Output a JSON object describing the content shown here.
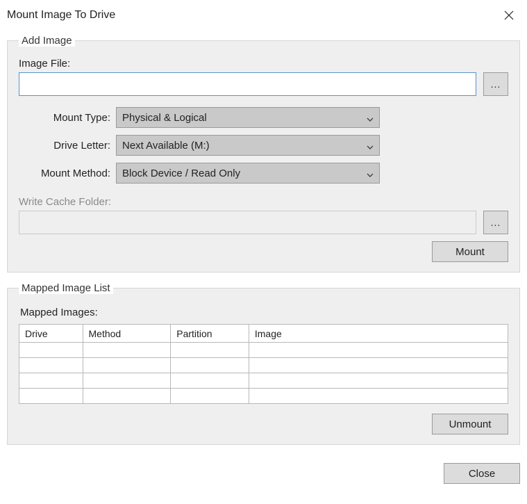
{
  "window": {
    "title": "Mount Image To Drive"
  },
  "addImage": {
    "legend": "Add Image",
    "imageFileLabel": "Image File:",
    "imageFileValue": "",
    "browseLabel": "...",
    "mountTypeLabel": "Mount Type:",
    "mountTypeValue": "Physical & Logical",
    "driveLetterLabel": "Drive Letter:",
    "driveLetterValue": "Next Available (M:)",
    "mountMethodLabel": "Mount Method:",
    "mountMethodValue": "Block Device / Read Only",
    "writeCacheLabel": "Write Cache Folder:",
    "writeCacheValue": "",
    "writeCacheBrowseLabel": "...",
    "mountButton": "Mount"
  },
  "mappedList": {
    "legend": "Mapped Image List",
    "tableLabel": "Mapped Images:",
    "columns": [
      "Drive",
      "Method",
      "Partition",
      "Image"
    ],
    "rows": [
      [
        "",
        "",
        "",
        ""
      ],
      [
        "",
        "",
        "",
        ""
      ],
      [
        "",
        "",
        "",
        ""
      ],
      [
        "",
        "",
        "",
        ""
      ]
    ],
    "unmountButton": "Unmount"
  },
  "footer": {
    "closeButton": "Close"
  }
}
